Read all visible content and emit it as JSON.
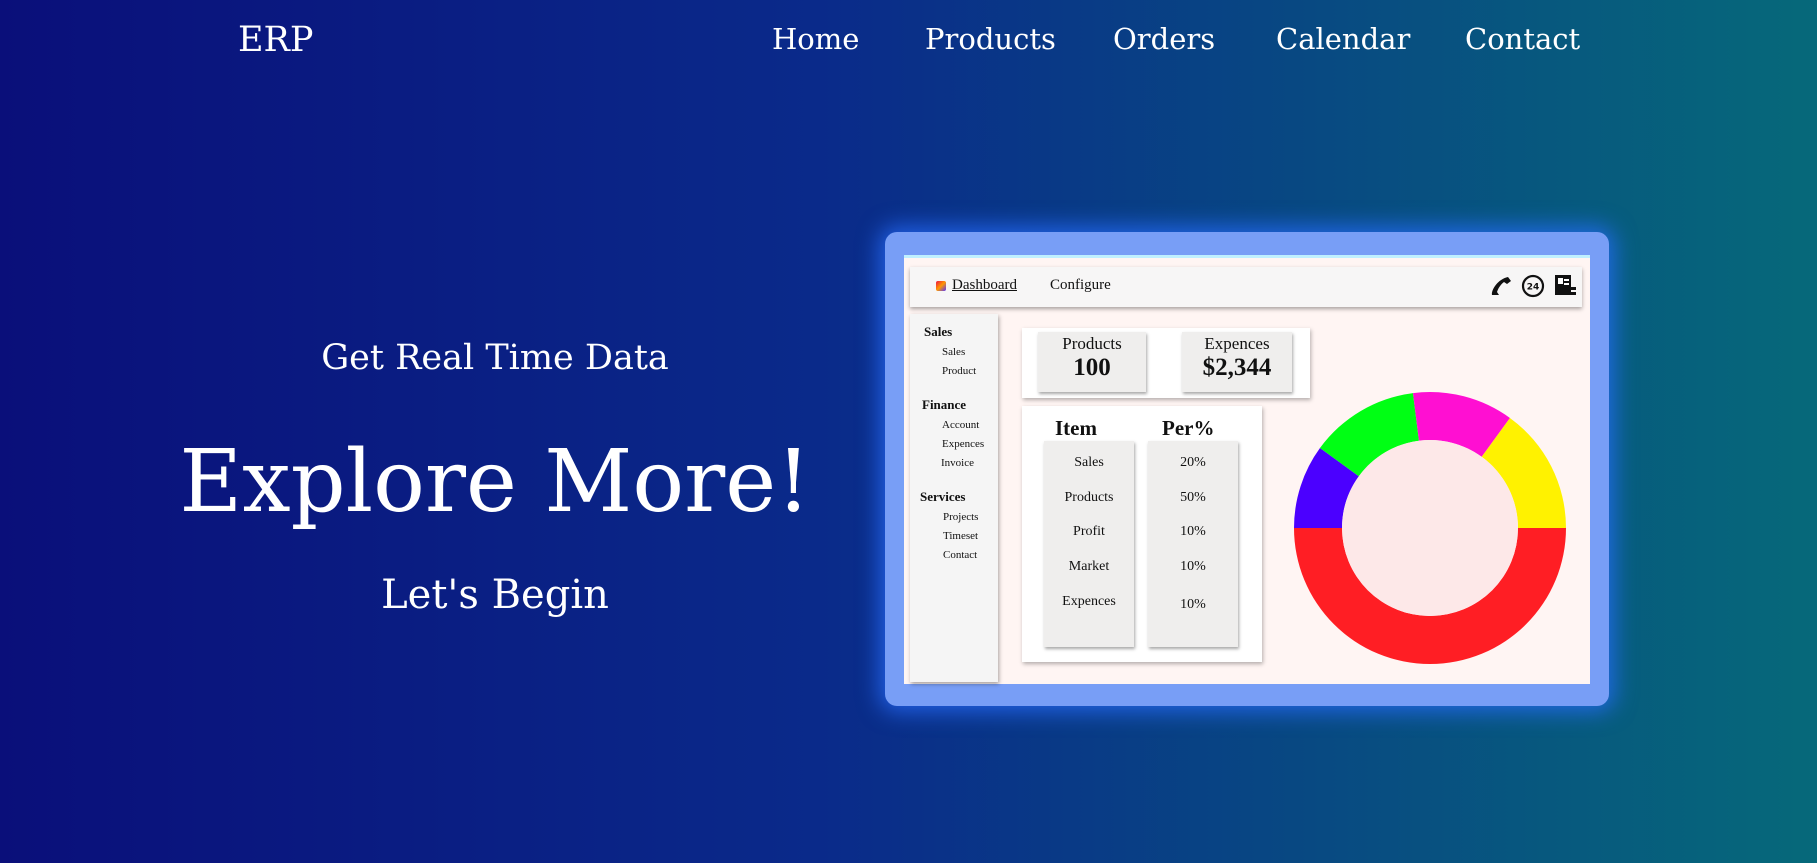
{
  "brand": "ERP",
  "nav": [
    "Home",
    "Products",
    "Orders",
    "Calendar",
    "Contact"
  ],
  "hero": {
    "tagline": "Get Real Time Data",
    "headline": "Explore More!",
    "cta": "Let's Begin"
  },
  "dashboard": {
    "tabs": {
      "dashboard": "Dashboard",
      "configure": "Configure"
    },
    "icons": [
      "phone-icon",
      "24-hours-icon",
      "contact-book-icon"
    ],
    "sidebar": [
      {
        "heading": "Sales",
        "items": [
          "Sales",
          "Product"
        ]
      },
      {
        "heading": "Finance",
        "items": [
          "Account",
          "Expences",
          "Invoice"
        ]
      },
      {
        "heading": "Services",
        "items": [
          "Projects",
          "Timeset",
          "Contact"
        ]
      }
    ],
    "kpis": [
      {
        "label": "Products",
        "value": "100"
      },
      {
        "label": "Expences",
        "value": "$2,344"
      }
    ],
    "table": {
      "headers": [
        "Item",
        "Per%"
      ],
      "rows": [
        [
          "Sales",
          "20%"
        ],
        [
          "Products",
          "50%"
        ],
        [
          "Profit",
          "10%"
        ],
        [
          "Market",
          "10%"
        ],
        [
          "Expences",
          "10%"
        ]
      ]
    },
    "donut": {
      "slices": [
        {
          "value": 50,
          "color": "#ff1e24"
        },
        {
          "value": 10,
          "color": "#4b00ff"
        },
        {
          "value": 13,
          "color": "#00ff14"
        },
        {
          "value": 12,
          "color": "#ff0fd2"
        },
        {
          "value": 15,
          "color": "#fff200"
        }
      ]
    }
  },
  "colors": {
    "bg_start": "#0a0f7a",
    "bg_end": "#06697a",
    "frame": "#789ef6",
    "glow": "#286eff"
  }
}
